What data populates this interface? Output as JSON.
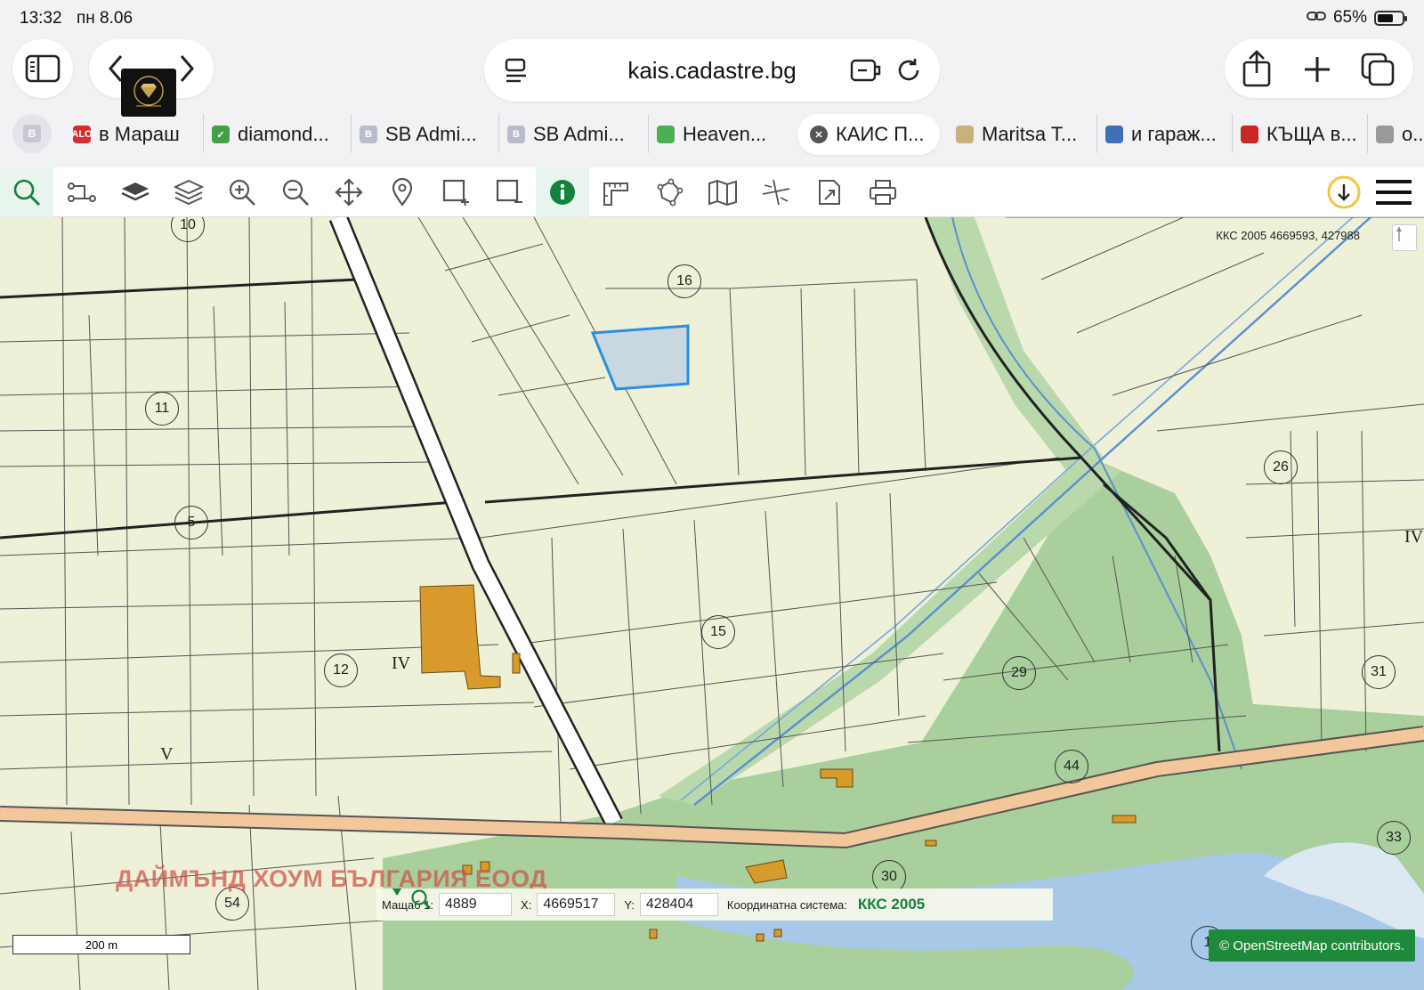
{
  "status": {
    "time": "13:32",
    "date": "пн 8.06",
    "battery": "65%",
    "battery_level": 0.65
  },
  "browser": {
    "url": "kais.cadastre.bg",
    "tabs": [
      {
        "label": "в Мараш",
        "fav_color": "#d32f2f",
        "fav_text": "ALO"
      },
      {
        "label": "diamond...",
        "fav_color": "#43a047",
        "fav_text": "✓"
      },
      {
        "label": "SB Admi...",
        "fav_color": "#b9bccd",
        "fav_text": "B"
      },
      {
        "label": "SB Admi...",
        "fav_color": "#b9bccd",
        "fav_text": "B"
      },
      {
        "label": "Heaven...",
        "fav_color": "#4caf50",
        "fav_text": ""
      },
      {
        "label": "КАИС П...",
        "fav_color": "#555555",
        "fav_text": "✕"
      },
      {
        "label": "Maritsa T...",
        "fav_color": "#c8b27a",
        "fav_text": ""
      },
      {
        "label": "и гараж...",
        "fav_color": "#3f6fb5",
        "fav_text": ""
      },
      {
        "label": "КЪЩА в...",
        "fav_color": "#c62828",
        "fav_text": ""
      },
      {
        "label": "о...",
        "fav_color": "#999999",
        "fav_text": ""
      }
    ]
  },
  "map": {
    "coord_readout": "ККС 2005 4669593, 427988",
    "parcels": [
      "10",
      "16",
      "11",
      "5",
      "26",
      "15",
      "12",
      "29",
      "31",
      "44",
      "33",
      "30",
      "54",
      "1"
    ],
    "romans": [
      "IV",
      "IV",
      "V"
    ],
    "watermark": "ДАЙМЪНД ХОУМ БЪЛГАРИЯ ЕООД",
    "scale_label": "Мащаб 1:",
    "scale_value": "4889",
    "x_label": "X:",
    "x_value": "4669517",
    "y_label": "Y:",
    "y_value": "428404",
    "coord_system_label": "Координатна система:",
    "coord_system": "ККС 2005",
    "scalebar": "200 m",
    "attribution": "© OpenStreetMap contributors."
  },
  "colors": {
    "accent": "#13823c",
    "parcel_fill": "#eef0d8",
    "forest": "#a9cf9c",
    "road": "#f3c79c",
    "building": "#d79a2b",
    "water": "#a7c8e6",
    "selected": "#c9d8e0"
  }
}
